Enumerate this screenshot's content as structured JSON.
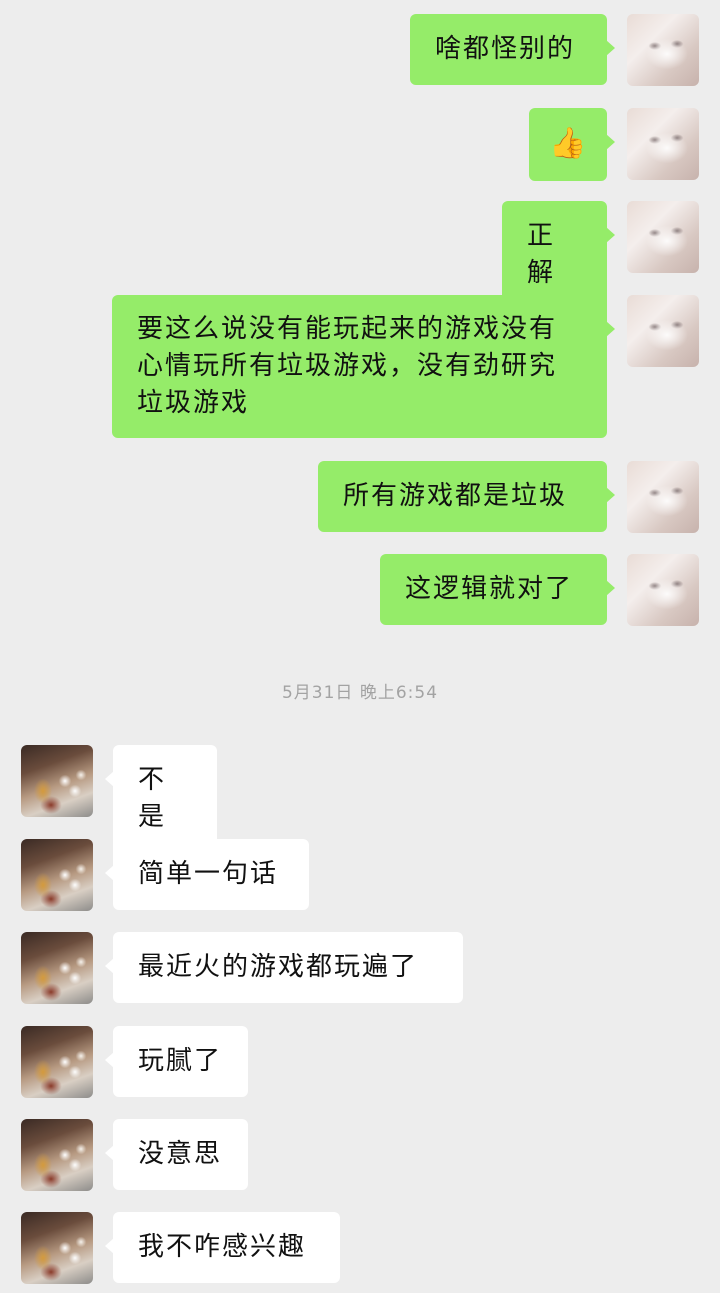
{
  "messages_before": [
    {
      "from": "me",
      "text": "啥都怪别的"
    },
    {
      "from": "me",
      "text": "👍",
      "icon": "thumbs-up-icon"
    },
    {
      "from": "me",
      "text": "正解"
    },
    {
      "from": "me",
      "text": "要这么说没有能玩起来的游戏没有心情玩所有垃圾游戏，没有劲研究垃圾游戏"
    },
    {
      "from": "me",
      "text": "所有游戏都是垃圾"
    },
    {
      "from": "me",
      "text": "这逻辑就对了"
    }
  ],
  "timestamp": "5月31日 晚上6:54",
  "messages_after": [
    {
      "from": "them",
      "text": "不是"
    },
    {
      "from": "them",
      "text": "简单一句话"
    },
    {
      "from": "them",
      "text": "最近火的游戏都玩遍了"
    },
    {
      "from": "them",
      "text": "玩腻了"
    },
    {
      "from": "them",
      "text": "没意思"
    },
    {
      "from": "them",
      "text": "我不咋感兴趣"
    }
  ],
  "colors": {
    "background": "#ededed",
    "my_bubble": "#95ec69",
    "their_bubble": "#ffffff",
    "timestamp_text": "#a3a3a3"
  }
}
